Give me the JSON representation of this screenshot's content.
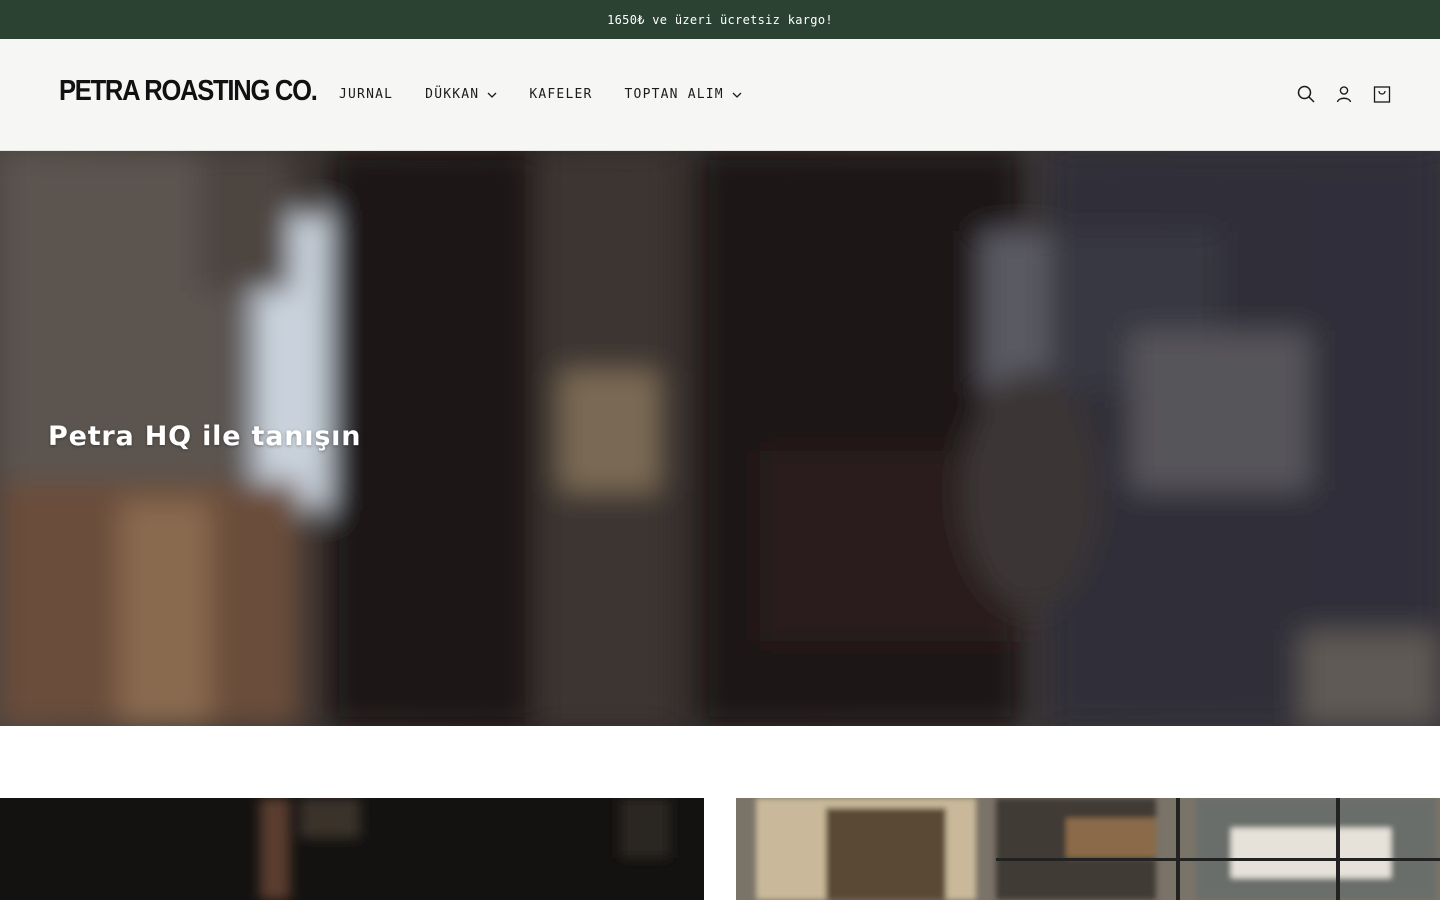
{
  "announcement": {
    "text": "1650₺ ve üzeri ücretsiz kargo!"
  },
  "header": {
    "logo": "PETRA ROASTING CO.",
    "nav": [
      {
        "label": "JURNAL",
        "has_dropdown": false
      },
      {
        "label": "DÜKKAN",
        "has_dropdown": true
      },
      {
        "label": "KAFELER",
        "has_dropdown": false
      },
      {
        "label": "TOPTAN ALIM",
        "has_dropdown": true
      }
    ],
    "icons": [
      "search-icon",
      "account-icon",
      "cart-icon"
    ]
  },
  "hero": {
    "title": "Petra HQ ile tanışın"
  },
  "colors": {
    "announcement_bg": "#2b4233",
    "header_bg": "#f6f6f5",
    "text": "#121212"
  }
}
